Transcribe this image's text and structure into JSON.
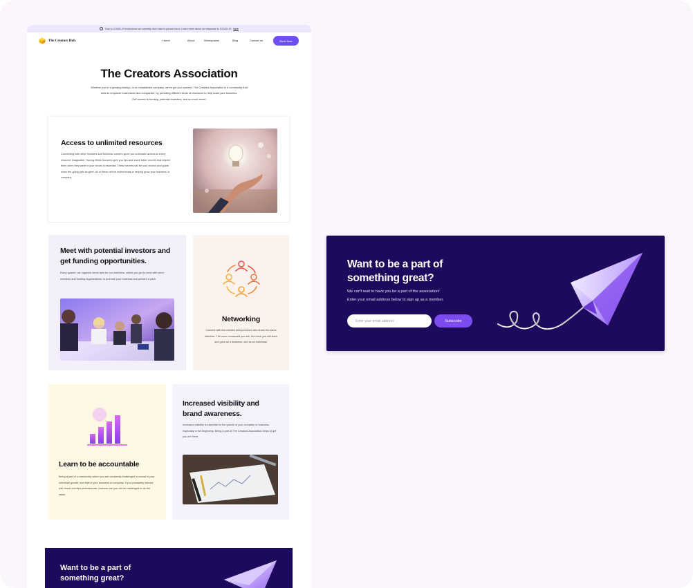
{
  "announcement": {
    "text": "Due to COVID-19 restrictions we currently don't take in-person tours. Learn more about our response to COVID-19",
    "link": "here"
  },
  "nav": {
    "brand": "The Creators Hub.",
    "links": [
      "Home",
      "About",
      "Workspaces",
      "Blog",
      "Contact us"
    ],
    "cta": "Book Now"
  },
  "hero": {
    "title": "The Creators Association",
    "line1": "Whether you're a growing startup, or an established company, we've got you covered. The Creators Association is a community that",
    "line2": "aims to empower businesses and companies, by providing different kinds of resources to help scale your business.",
    "line3": "Get access to funding, potential investors, and so much more!"
  },
  "cards": {
    "resources": {
      "title": "Access to unlimited resources",
      "body": "Connecting with other founders and business owners gives you automatic access to every resource imaginable. Having fellow founders give you tips and share trade secrets that helped them when they were in your shoes is essential. These secrets will be your anchor and guide when the going gets tougher. All of these will be instrumental in helping grow your business or company."
    },
    "investors": {
      "title": "Meet with potential investors and get funding opportunities.",
      "body": "Every quarter, we organize demo fairs for our members, where you get to meet with seed investors and funding organizations, to promote your business and present a pitch."
    },
    "networking": {
      "title": "Networking",
      "body": "Connect with like-minded entrepreneurs who share the same interests. The more connected you are, the more you will learn and grow as a business, and as an individual."
    },
    "accountable": {
      "title": "Learn to be accountable",
      "body": "Being a part of a community where you are constantly challenged is crucial to your individual growth, and that of your business or company. If you constantly interact with result oriented professionals, chances are you will be challenged to do the same."
    },
    "visibility": {
      "title": "Increased visibility and brand awareness.",
      "body": "Increased visibility is essential for the growth of your company or business, especially in the beginning. Being a part of The Creators Association helps to get you out there."
    }
  },
  "cta": {
    "title": "Want to be a part of something great?",
    "line1": "We can't wait to have you be a part of the association!",
    "line2": "Enter your email address below to sign up as a member.",
    "email_placeholder": "Enter your email address",
    "button": "Subscribe"
  },
  "cta_small": {
    "title": "Want to be a part of something great?"
  },
  "colors": {
    "accent": "#6f4ef2",
    "cta_bg": "#1e0a5c",
    "page_bg": "#fbf5fe",
    "networking_icon": "#f08a3c"
  },
  "icons": [
    "info-icon",
    "cube-logo-icon",
    "people-network-icon",
    "bar-chart-icon",
    "paper-plane-icon"
  ]
}
